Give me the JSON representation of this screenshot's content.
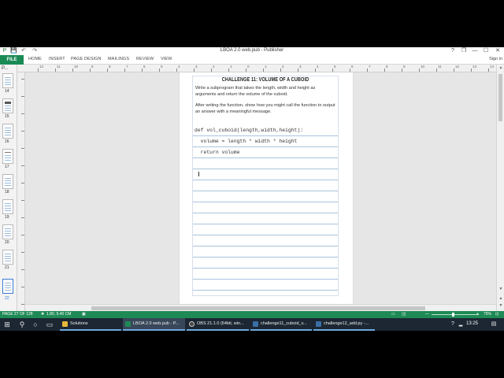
{
  "window": {
    "title": "LBOA 2.0 web.pub - Publisher",
    "controls": {
      "help": "?",
      "restore": "❐",
      "minimize": "—",
      "maximize": "☐",
      "close": "✕"
    }
  },
  "quick_access": {
    "save_icon": "💾",
    "undo_icon": "↶",
    "redo_icon": "↷"
  },
  "ribbon": {
    "file": "FILE",
    "tabs": [
      "HOME",
      "INSERT",
      "PAGE DESIGN",
      "MAILINGS",
      "REVIEW",
      "VIEW"
    ],
    "signin": "Sign in"
  },
  "pages_pane": {
    "header": "P...",
    "thumbnails": [
      "14",
      "15",
      "16",
      "17",
      "18",
      "19",
      "20",
      "21",
      "22"
    ],
    "selected": "22"
  },
  "ruler": {
    "labels": [
      "12",
      "11",
      "10",
      "9",
      "8",
      "7",
      "6",
      "5",
      "4",
      "3",
      "2",
      "1",
      "0",
      "1",
      "2",
      "3",
      "4",
      "5",
      "6",
      "7",
      "8",
      "9",
      "10",
      "11",
      "12",
      "13",
      "14",
      "15"
    ]
  },
  "document": {
    "heading": "CHALLENGE 11: VOLUME OF A CUBOID",
    "paragraph1": "Write a subprogram that takes the length, width and height as arguments and return the volume of the cuboid.",
    "paragraph2": "After writing the function, show how you might call the function to output an answer with a meaningful message.",
    "code_lines": [
      "def vol_cuboid(length,width,height):",
      "  volume = length * width * height",
      "  return volume",
      "",
      "",
      "",
      "",
      "",
      "",
      "",
      "",
      "",
      "",
      "",
      ""
    ]
  },
  "status": {
    "page": "PAGE 27 OF 128",
    "position": "1.80, 9.40 CM",
    "zoom": "75%"
  },
  "taskbar": {
    "apps": [
      {
        "label": "Solutions",
        "color": "#e8b73a"
      },
      {
        "label": "LBOA 2.0 web.pub - P...",
        "color": "#1e8a55"
      },
      {
        "label": "OBS 21.1.0 (64bit, win...",
        "color": "#444444"
      },
      {
        "label": "challenge11_cuboid_v...",
        "color": "#3a6ea5"
      },
      {
        "label": "challenge12_add.py -...",
        "color": "#3a6ea5"
      }
    ],
    "clock": "13:25"
  },
  "colors": {
    "accent": "#1e8a55",
    "taskbar": "#1c2733",
    "rule_line": "#a9c4de"
  }
}
